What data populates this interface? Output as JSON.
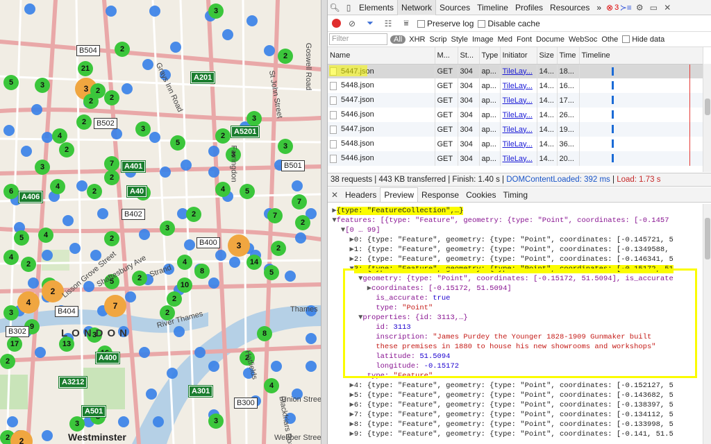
{
  "devtools": {
    "tabs": [
      "Elements",
      "Network",
      "Sources",
      "Timeline",
      "Profiles",
      "Resources"
    ],
    "more": "»",
    "error_count": "3",
    "toolbar": {
      "preserve_log": "Preserve log",
      "disable_cache": "Disable cache"
    },
    "filter_placeholder": "Filter",
    "filters": [
      "All",
      "XHR",
      "Scrip",
      "Style",
      "Image",
      "Med",
      "Font",
      "Docume",
      "WebSoc",
      "Othe"
    ],
    "hide_data": "Hide data",
    "columns": [
      "Name",
      "M...",
      "St...",
      "Type",
      "Initiator",
      "Size",
      "Time",
      "Timeline"
    ],
    "rows": [
      {
        "name": "5447.json",
        "method": "GET",
        "status": "304",
        "type": "ap...",
        "initiator": "TileLay...",
        "size": "14...",
        "time": "18..."
      },
      {
        "name": "5448.json",
        "method": "GET",
        "status": "304",
        "type": "ap...",
        "initiator": "TileLay...",
        "size": "14...",
        "time": "16..."
      },
      {
        "name": "5447.json",
        "method": "GET",
        "status": "304",
        "type": "ap...",
        "initiator": "TileLay...",
        "size": "14...",
        "time": "17..."
      },
      {
        "name": "5446.json",
        "method": "GET",
        "status": "304",
        "type": "ap...",
        "initiator": "TileLay...",
        "size": "14...",
        "time": "26..."
      },
      {
        "name": "5447.json",
        "method": "GET",
        "status": "304",
        "type": "ap...",
        "initiator": "TileLay...",
        "size": "14...",
        "time": "19..."
      },
      {
        "name": "5448.json",
        "method": "GET",
        "status": "304",
        "type": "ap...",
        "initiator": "TileLay...",
        "size": "14...",
        "time": "36..."
      },
      {
        "name": "5446.json",
        "method": "GET",
        "status": "304",
        "type": "ap...",
        "initiator": "TileLay...",
        "size": "14...",
        "time": "20..."
      }
    ],
    "status": {
      "requests": "38 requests",
      "transferred": "443 KB transferred",
      "finish": "Finish: 1.40 s",
      "dom": "DOMContentLoaded: 392 ms",
      "load": "Load: 1.73 s"
    },
    "subtabs": [
      "Headers",
      "Preview",
      "Response",
      "Cookies",
      "Timing"
    ],
    "preview": {
      "l0": "{type: \"FeatureCollection\",…}",
      "l1": "features: [{type: \"Feature\", geometry: {type: \"Point\", coordinates: [-0.1457",
      "l2": "[0 … 99]",
      "l3": "0: {type: \"Feature\", geometry: {type: \"Point\", coordinates: [-0.145721, 5",
      "l4": "1: {type: \"Feature\", geometry: {type: \"Point\", coordinates: [-0.1349588,",
      "l5": "2: {type: \"Feature\", geometry: {type: \"Point\", coordinates: [-0.146341, 5",
      "l6": "3: {type: \"Feature\", geometry: {type: \"Point\", coordinates: [-0.15172, 51",
      "l7": "geometry: {type: \"Point\", coordinates: [-0.15172, 51.5094], is_accurate",
      "l8": "coordinates: [-0.15172, 51.5094]",
      "l9k": "is_accurate:",
      "l9v": "true",
      "l10k": "type:",
      "l10v": "\"Point\"",
      "l11": "properties: {id: 3113,…}",
      "l12k": "id:",
      "l12v": "3113",
      "l13k": "inscription:",
      "l13v": "\"James Purdey the Younger 1828-1909 Gunmaker built",
      "l14": "these premises in 1880 to house his new showrooms and workshops\"",
      "l15k": "latitude:",
      "l15v": "51.5094",
      "l16k": "longitude:",
      "l16v": "-0.15172",
      "l17k": "type:",
      "l17v": "\"Feature\"",
      "l18": "4: {type: \"Feature\", geometry: {type: \"Point\", coordinates: [-0.152127, 5",
      "l19": "5: {type: \"Feature\", geometry: {type: \"Point\", coordinates: [-0.143682, 5",
      "l20": "6: {type: \"Feature\", geometry: {type: \"Point\", coordinates: [-0.138397, 5",
      "l21": "7: {type: \"Feature\", geometry: {type: \"Point\", coordinates: [-0.134112, 5",
      "l22": "8: {type: \"Feature\", geometry: {type: \"Point\", coordinates: [-0.133998, 5",
      "l23": "9: {type: \"Feature\", geometry: {type: \"Point\", coordinates: [-0.141, 51.5"
    }
  },
  "map": {
    "roads": [
      "B504",
      "A201",
      "B502",
      "A5201",
      "A401",
      "A40",
      "B402",
      "A400",
      "A3212",
      "B300",
      "B501",
      "B404",
      "B302",
      "A301",
      "A501",
      "A406",
      "B400"
    ],
    "places": [
      "Grays Inn Road",
      "Goswell Road",
      "St John Street",
      "Farringdon",
      "Lisson Grove Street",
      "Shaftesbury Ave",
      "Strand",
      "River Thames",
      "Thames",
      "Union Street",
      "Webber Street",
      "Blackfriars Road",
      "Hatfields",
      "Westminster",
      "LONDON"
    ],
    "clusters": [
      "3",
      "2",
      "21",
      "5",
      "3",
      "3",
      "2",
      "2",
      "3",
      "5",
      "2",
      "3",
      "3",
      "3",
      "4",
      "2",
      "2",
      "3",
      "7",
      "6",
      "4",
      "2",
      "4",
      "4",
      "5",
      "7",
      "2",
      "2",
      "7",
      "3",
      "2",
      "4",
      "3",
      "5",
      "2",
      "4",
      "2",
      "14",
      "5",
      "4",
      "8",
      "5",
      "2",
      "5",
      "4",
      "2",
      "7",
      "9",
      "3",
      "13",
      "17",
      "16",
      "8",
      "2",
      "4",
      "3",
      "3",
      "2",
      "2",
      "8",
      "2",
      "10",
      "2",
      "2",
      "2",
      "2",
      "3",
      "2",
      "3"
    ]
  }
}
